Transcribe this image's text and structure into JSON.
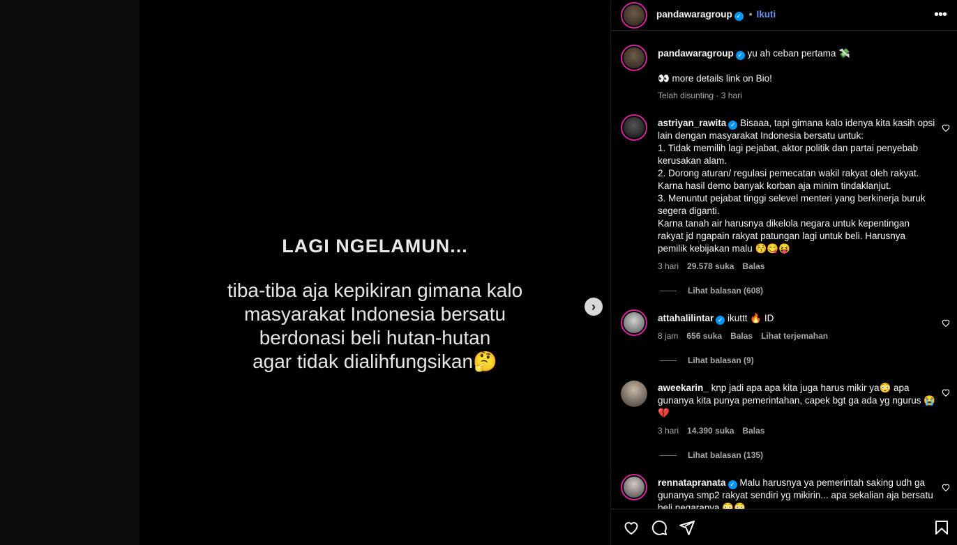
{
  "post": {
    "title": "LAGI NGELAMUN...",
    "body_lines": [
      "tiba-tiba aja kepikiran gimana kalo",
      "masyarakat Indonesia bersatu",
      "berdonasi beli hutan-hutan",
      "agar tidak dialihfungsikan🤔"
    ]
  },
  "header": {
    "username": "pandawaragroup",
    "follow": "Ikuti"
  },
  "caption": {
    "username": "pandawaragroup",
    "text": "yu ah ceban pertama 💸",
    "line2": "👀 more details link on Bio!",
    "meta": "Telah disunting · 3 hari"
  },
  "comments": [
    {
      "username": "astriyan_rawita",
      "text": "Bisaaa, tapi gimana kalo idenya kita kasih opsi lain dengan masyarakat Indonesia bersatu untuk:",
      "lines": [
        "1. Tidak memilih lagi pejabat, aktor politik dan partai penyebab kerusakan alam.",
        "2. Dorong aturan/ regulasi pemecatan wakil rakyat oleh rakyat. Karna hasil demo banyak korban aja minim tindaklanjut.",
        "3. Menuntut pejabat tinggi selevel menteri yang berkinerja buruk segera diganti.",
        "Karna tanah air harusnya dikelola negara untuk kepentingan rakyat jd ngapain rakyat patungan lagi untuk beli. Harusnya pemilik kebijakan malu 😚😋😝"
      ],
      "time": "3 hari",
      "likes": "29.578 suka",
      "reply": "Balas",
      "replies": "Lihat balasan (608)"
    },
    {
      "username": "attahalilintar",
      "text": "ikuttt 🔥 ID",
      "time": "8 jam",
      "likes": "656 suka",
      "reply": "Balas",
      "translate": "Lihat terjemahan",
      "replies": "Lihat balasan (9)"
    },
    {
      "username": "aweekarin_",
      "text": "knp jadi apa apa kita juga harus mikir ya😳 apa gunanya kita punya pemerintahan, capek bgt ga ada yg ngurus 😭💔",
      "time": "3 hari",
      "likes": "14.390 suka",
      "reply": "Balas",
      "replies": "Lihat balasan (135)"
    },
    {
      "username": "rennatapranata",
      "text": "Malu harusnya ya pemerintah saking udh ga gunanya smp2 rakyat sendiri yg mikirin... apa sekalian aja bersatu beli negaranya 😳😳"
    }
  ],
  "icons": [
    "heart-icon",
    "comment-icon",
    "share-icon",
    "bookmark-icon",
    "more-icon",
    "chevron-right-icon",
    "verified-icon"
  ],
  "colors": {
    "accent": "#0095f6",
    "follow": "#5f94f0",
    "ring": "#d6249f",
    "muted": "#a8a8a8"
  }
}
